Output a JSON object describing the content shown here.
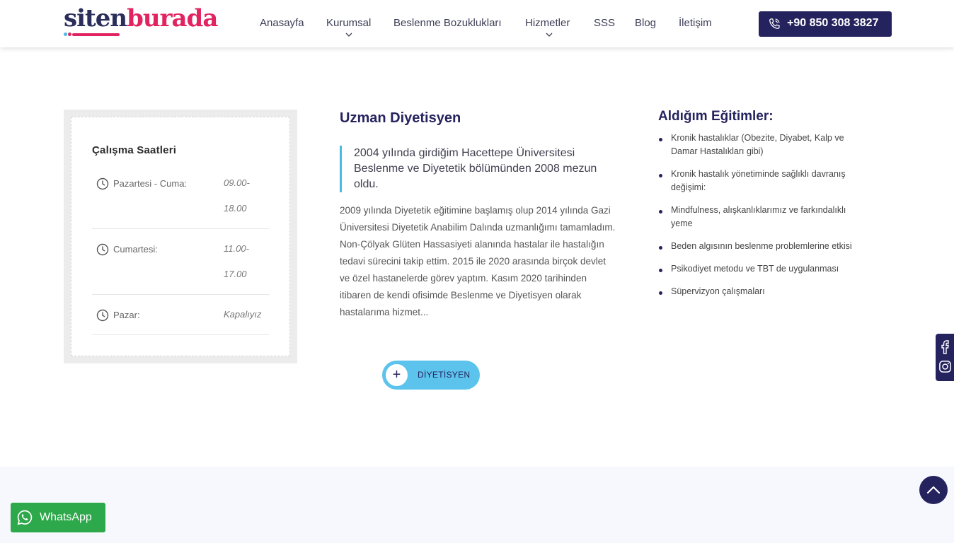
{
  "brand": {
    "part1": "siten",
    "part2": "burada"
  },
  "nav": {
    "items": [
      {
        "label": "Anasayfa",
        "dropdown": false
      },
      {
        "label": "Kurumsal",
        "dropdown": true
      },
      {
        "label": "Beslenme Bozuklukları",
        "dropdown": false
      },
      {
        "label": "Hizmetler",
        "dropdown": true
      },
      {
        "label": "SSS",
        "dropdown": false
      },
      {
        "label": "Blog",
        "dropdown": false
      },
      {
        "label": "İletişim",
        "dropdown": false
      }
    ],
    "phone": "+90 850 308 3827"
  },
  "hours": {
    "title": "Çalışma Saatleri",
    "rows": [
      {
        "day": "Pazartesi - Cuma:",
        "time_line1": "09.00-",
        "time_line2": "18.00"
      },
      {
        "day": "Cumartesi:",
        "time_line1": "11.00-",
        "time_line2": "17.00"
      },
      {
        "day": "Pazar:",
        "time_line1": "Kapalıyız",
        "time_line2": ""
      }
    ]
  },
  "about": {
    "title": "Uzman Diyetisyen",
    "quote": "2004 yılında girdiğim Hacettepe Üniversitesi Beslenme ve Diyetetik bölümünden 2008 mezun oldu.",
    "paragraph": "2009 yılında Diyetetik eğitimine başlamış olup 2014 yılında Gazi Üniversitesi Diyetetik Anabilim Dalında uzmanlığımı tamamladım. Non-Çölyak Glüten Hassasiyeti alanında hastalar ile hastalığın tedavi sürecini takip ettim. 2015 ile 2020 arasında birçok devlet ve özel hastanelerde görev yaptım. Kasım 2020 tarihinden itibaren de kendi ofisimde Beslenme ve Diyetisyen olarak hastalarıma hizmet...",
    "button_plus": "+",
    "button_label": "DİYETİSYEN"
  },
  "education": {
    "title": "Aldığım Eğitimler:",
    "items": [
      "Kronik hastalıklar (Obezite, Diyabet, Kalp ve Damar Hastalıkları gibi)",
      "Kronik hastalık yönetiminde sağlıklı davranış değişimi:",
      "Mindfulness, alışkanlıklarımız ve farkındalıklı yeme",
      "Beden algısının beslenme problemlerine etkisi",
      "Psikodiyet metodu ve TBT de uygulanması",
      "Süpervizyon çalışmaları"
    ]
  },
  "whatsapp": {
    "label": "WhatsApp"
  },
  "colors": {
    "navy": "#25235e",
    "pink": "#e1245f",
    "cyan": "#5bc3ec",
    "whatsapp": "#2da84a"
  },
  "icons": [
    "phone-icon",
    "clock-icon",
    "facebook-icon",
    "instagram-icon",
    "arrow-up-icon",
    "whatsapp-icon",
    "chevron-down-icon"
  ]
}
